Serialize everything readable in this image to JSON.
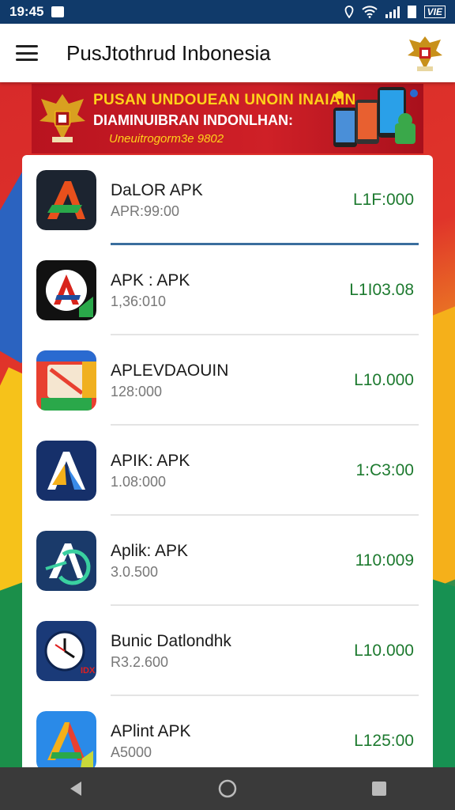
{
  "status_bar": {
    "time": "19:45",
    "network_badge": "VIE"
  },
  "app_bar": {
    "title": "PusJtothrud Inbonesia"
  },
  "banner": {
    "line1": "PUSAN UNDOUEAN UNOIN INAIAIN",
    "line2": "DIAMINUIBRAN INDONLHAN:",
    "line3": "Uneuitrogorm3e 9802"
  },
  "apps": [
    {
      "name": "DaLOR APK",
      "sub": "APR:99:00",
      "price": "L1F:000",
      "icon": "red-green-a-logo-icon"
    },
    {
      "name": "APK : APK",
      "sub": "1,36:010",
      "price": "L1I03.08",
      "icon": "red-a-badge-logo-icon"
    },
    {
      "name": "APLEVDAOUIN",
      "sub": "128:000",
      "price": "L10.000",
      "icon": "colorful-folder-logo-icon"
    },
    {
      "name": "APIK: APK",
      "sub": "1.08:000",
      "price": "1:C3:00",
      "icon": "blue-yellow-a-logo-icon"
    },
    {
      "name": "Aplik: APK",
      "sub": "3.0.500",
      "price": "110:009",
      "icon": "green-blue-a-logo-icon"
    },
    {
      "name": "Bunic Datlondhk",
      "sub": "R3.2.600",
      "price": "L10.000",
      "icon": "clock-logo-icon"
    },
    {
      "name": "APlint APK",
      "sub": "A5000",
      "price": "L125:00",
      "icon": "google-a-logo-icon"
    }
  ],
  "colors": {
    "accent": "#1d7a2f",
    "status_bar": "#103a6a",
    "banner_red": "#cf2027"
  }
}
